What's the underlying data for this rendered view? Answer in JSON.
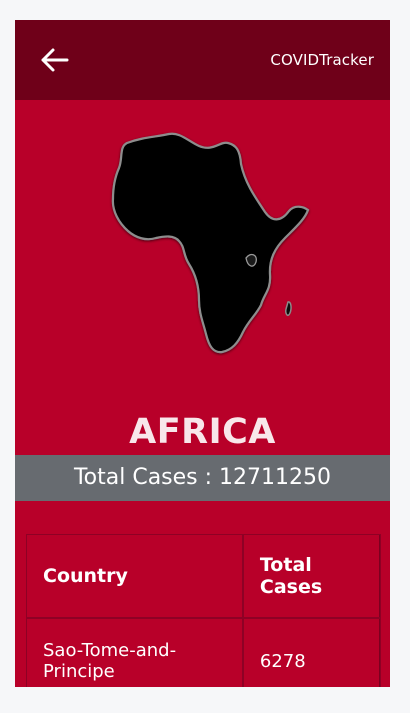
{
  "app_bar": {
    "title": "COVIDTracker",
    "back_icon": "arrow-left-icon"
  },
  "region": {
    "map_icon": "africa-map-icon",
    "name": "AFRICA",
    "total_cases_label": "Total Cases : 12711250"
  },
  "table": {
    "headers": [
      "Country",
      "Total Cases"
    ],
    "rows": [
      {
        "country": "Sao-Tome-and-Principe",
        "total_cases": "6278"
      }
    ]
  },
  "colors": {
    "primary": "#b80029",
    "app_bar": "#6f0019",
    "total_bar": "#676b70"
  }
}
